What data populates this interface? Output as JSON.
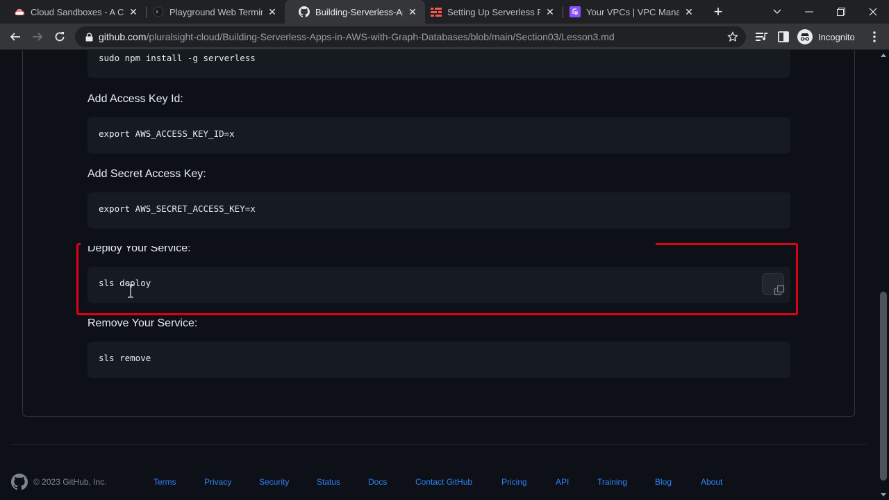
{
  "browser": {
    "tabs": [
      {
        "title": "Cloud Sandboxes - A Clou",
        "icon": "cloud-icon",
        "active": false
      },
      {
        "title": "Playground Web Terminal",
        "icon": "terminal-icon",
        "active": false
      },
      {
        "title": "Building-Serverless-Apps",
        "icon": "github-icon",
        "active": true
      },
      {
        "title": "Setting Up Serverless Fran",
        "icon": "serverless-icon",
        "active": false
      },
      {
        "title": "Your VPCs | VPC Managem",
        "icon": "vpc-icon",
        "active": false
      }
    ],
    "url_host": "github.com",
    "url_path": "/pluralsight-cloud/Building-Serverless-Apps-in-AWS-with-Graph-Databases/blob/main/Section03/Lesson3.md",
    "profile_label": "Incognito"
  },
  "markdown": {
    "code_install": "sudo npm install -g serverless",
    "label_access_key": "Add Access Key Id:",
    "code_access_key": "export AWS_ACCESS_KEY_ID=x",
    "label_secret_key": "Add Secret Access Key:",
    "code_secret_key": "export AWS_SECRET_ACCESS_KEY=x",
    "label_deploy": "Deploy Your Service:",
    "code_deploy": "sls deploy",
    "label_remove": "Remove Your Service:",
    "code_remove": "sls remove"
  },
  "footer": {
    "copyright": "© 2023 GitHub, Inc.",
    "links": [
      "Terms",
      "Privacy",
      "Security",
      "Status",
      "Docs",
      "Contact GitHub",
      "Pricing",
      "API",
      "Training",
      "Blog",
      "About"
    ]
  },
  "colors": {
    "highlight_box": "#e00015",
    "link": "#2f81f7",
    "code_bg": "#161b22"
  }
}
